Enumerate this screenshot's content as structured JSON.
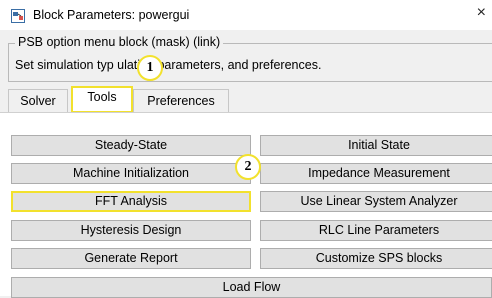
{
  "window": {
    "title": "Block Parameters: powergui",
    "close_glyph": "×"
  },
  "group": {
    "title": "PSB option menu block (mask) (link)",
    "description": "Set simulation typ       ulation parameters, and preferences."
  },
  "tabs": [
    {
      "label": "Solver",
      "active": false
    },
    {
      "label": "Tools",
      "active": true
    },
    {
      "label": "Preferences",
      "active": false
    }
  ],
  "buttons": {
    "steady_state": "Steady-State",
    "initial_state": "Initial State",
    "machine_initialization": "Machine Initialization",
    "impedance_measurement": "Impedance Measurement",
    "fft_analysis": "FFT Analysis",
    "linear_system_analyzer": "Use Linear System Analyzer",
    "hysteresis_design": "Hysteresis Design",
    "rlc_line_parameters": "RLC Line Parameters",
    "generate_report": "Generate Report",
    "customize_sps_blocks": "Customize SPS blocks",
    "load_flow": "Load Flow"
  },
  "annotations": {
    "step1": "1",
    "step2": "2"
  },
  "colors": {
    "highlight": "#f2e12d",
    "button_face": "#e1e1e1",
    "panel": "#ffffff"
  }
}
